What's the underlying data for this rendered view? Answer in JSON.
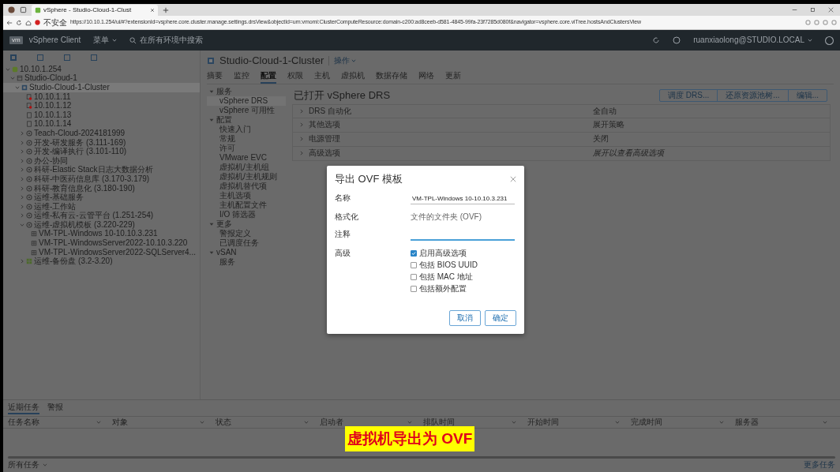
{
  "browser": {
    "tabs": [
      {
        "title": "vSphere - Studio-Cloud-1-Clust",
        "selected": true
      }
    ],
    "address": {
      "security": "不安全",
      "url": "https://10.10.1.254/ui/#?extensionId=vsphere.core.cluster.manage.settings.drsView&objectId=urn:vmomi:ClusterComputeResource:domain-c200:ad8ceeb-d581-4845-99fa-23f7285d080f&navigator=vsphere.core.viTree.hostsAndClustersView"
    }
  },
  "header": {
    "logo": "vm",
    "product": "vSphere Client",
    "menu": "菜单",
    "search_placeholder": "在所有环境中搜索",
    "user": "ruanxiaolong@STUDIO.LOCAL"
  },
  "tree": [
    {
      "label": "10.10.1.254",
      "kind": "vcenter",
      "expanded": true,
      "selected": false,
      "children": [
        {
          "label": "Studio-Cloud-1",
          "kind": "datacenter",
          "expanded": true,
          "selected": false,
          "children": [
            {
              "label": "Studio-Cloud-1-Cluster",
              "kind": "cluster",
              "expanded": true,
              "selected": true,
              "children": [
                {
                  "label": "10.10.1.11",
                  "kind": "host-alert",
                  "selected": false
                },
                {
                  "label": "10.10.1.12",
                  "kind": "host-alert",
                  "selected": false
                },
                {
                  "label": "10.10.1.13",
                  "kind": "host",
                  "selected": false
                },
                {
                  "label": "10.10.1.14",
                  "kind": "host",
                  "selected": false
                },
                {
                  "label": "Teach-Cloud-2024181999",
                  "kind": "pool",
                  "expanded": false,
                  "selected": false
                },
                {
                  "label": "开发-研发服务 (3.111-169)",
                  "kind": "pool",
                  "expanded": false,
                  "selected": false
                },
                {
                  "label": "开发-编译执行 (3.101-110)",
                  "kind": "pool",
                  "expanded": false,
                  "selected": false
                },
                {
                  "label": "办公-协同",
                  "kind": "pool",
                  "expanded": false,
                  "selected": false
                },
                {
                  "label": "科研-Elastic Stack日志大数据分析",
                  "kind": "pool",
                  "expanded": false,
                  "selected": false
                },
                {
                  "label": "科研-中医药信息库 (3.170-3.179)",
                  "kind": "pool",
                  "expanded": false,
                  "selected": false
                },
                {
                  "label": "科研-教育信息化 (3.180-190)",
                  "kind": "pool",
                  "expanded": false,
                  "selected": false
                },
                {
                  "label": "运维-基础服务",
                  "kind": "pool",
                  "expanded": false,
                  "selected": false
                },
                {
                  "label": "运维-工作站",
                  "kind": "pool",
                  "expanded": false,
                  "selected": false
                },
                {
                  "label": "运维-私有云-云管平台 (1.251-254)",
                  "kind": "pool",
                  "expanded": false,
                  "selected": false
                },
                {
                  "label": "运维-虚拟机模板 (3.220-229)",
                  "kind": "pool",
                  "expanded": true,
                  "selected": false,
                  "children": [
                    {
                      "label": "VM-TPL-Windows 10-10.10.3.231",
                      "kind": "template",
                      "selected": false
                    },
                    {
                      "label": "VM-TPL-WindowsServer2022-10.10.3.220",
                      "kind": "template",
                      "selected": false
                    },
                    {
                      "label": "VM-TPL-WindowsServer2022-SQLServer4...",
                      "kind": "template",
                      "selected": false
                    }
                  ]
                },
                {
                  "label": "运维-备份盘 (3.2-3.20)",
                  "kind": "vapp",
                  "expanded": false,
                  "selected": false
                }
              ]
            }
          ]
        }
      ]
    }
  ],
  "object": {
    "title": "Studio-Cloud-1-Cluster",
    "actions": "操作"
  },
  "tabs": [
    {
      "label": "摘要",
      "selected": false
    },
    {
      "label": "监控",
      "selected": false
    },
    {
      "label": "配置",
      "selected": true
    },
    {
      "label": "权限",
      "selected": false
    },
    {
      "label": "主机",
      "selected": false
    },
    {
      "label": "虚拟机",
      "selected": false
    },
    {
      "label": "数据存储",
      "selected": false
    },
    {
      "label": "网络",
      "selected": false
    },
    {
      "label": "更新",
      "selected": false
    }
  ],
  "config_nav": [
    {
      "label": "服务",
      "expanded": true,
      "items": [
        {
          "label": "vSphere DRS",
          "selected": true
        },
        {
          "label": "vSphere 可用性",
          "selected": false
        }
      ]
    },
    {
      "label": "配置",
      "expanded": true,
      "items": [
        {
          "label": "快速入门",
          "selected": false
        },
        {
          "label": "常规",
          "selected": false
        },
        {
          "label": "许可",
          "selected": false
        },
        {
          "label": "VMware EVC",
          "selected": false
        },
        {
          "label": "虚拟机/主机组",
          "selected": false
        },
        {
          "label": "虚拟机/主机规则",
          "selected": false
        },
        {
          "label": "虚拟机替代项",
          "selected": false
        },
        {
          "label": "主机选项",
          "selected": false
        },
        {
          "label": "主机配置文件",
          "selected": false
        },
        {
          "label": "I/O 筛选器",
          "selected": false
        }
      ]
    },
    {
      "label": "更多",
      "expanded": true,
      "items": [
        {
          "label": "警报定义",
          "selected": false
        },
        {
          "label": "已调度任务",
          "selected": false
        }
      ]
    },
    {
      "label": "vSAN",
      "expanded": true,
      "items": [
        {
          "label": "服务",
          "selected": false
        }
      ]
    }
  ],
  "drs": {
    "title": "已打开 vSphere DRS",
    "buttons": [
      "调度 DRS...",
      "还原资源池树...",
      "编辑..."
    ],
    "rows": [
      {
        "label": "DRS 自动化",
        "value": "全自动",
        "kind": "value"
      },
      {
        "label": "其他选项",
        "value": "展开策略",
        "kind": "value"
      },
      {
        "label": "电源管理",
        "value": "关闭",
        "kind": "value"
      },
      {
        "label": "高级选项",
        "value": "展开以查看高级选项",
        "kind": "hint"
      }
    ]
  },
  "dialog": {
    "title": "导出 OVF 模板",
    "fields": [
      {
        "kind": "input",
        "label": "名称",
        "value": "VM-TPL-Windows 10-10.10.3.231",
        "focused": false
      },
      {
        "kind": "text",
        "label": "格式化",
        "value": "文件的文件夹 (OVF)"
      },
      {
        "kind": "input",
        "label": "注释",
        "focused": true
      },
      {
        "kind": "checks",
        "label": "高级",
        "options": [
          {
            "label": "启用高级选项",
            "checked": true
          },
          {
            "label": "包括 BIOS UUID",
            "checked": false
          },
          {
            "label": "包括 MAC 地址",
            "checked": false
          },
          {
            "label": "包括额外配置",
            "checked": false
          }
        ]
      }
    ],
    "buttons": [
      "取消",
      "确定"
    ]
  },
  "tasks": {
    "tabs": [
      {
        "label": "近期任务",
        "selected": true
      },
      {
        "label": "警报",
        "selected": false
      }
    ],
    "columns": [
      "任务名称",
      "对象",
      "状态",
      "启动者",
      "排队时间",
      "开始时间",
      "完成时间",
      "服务器"
    ],
    "filter": "所有任务",
    "more": "更多任务"
  },
  "caption": "虚拟机导出为 OVF"
}
